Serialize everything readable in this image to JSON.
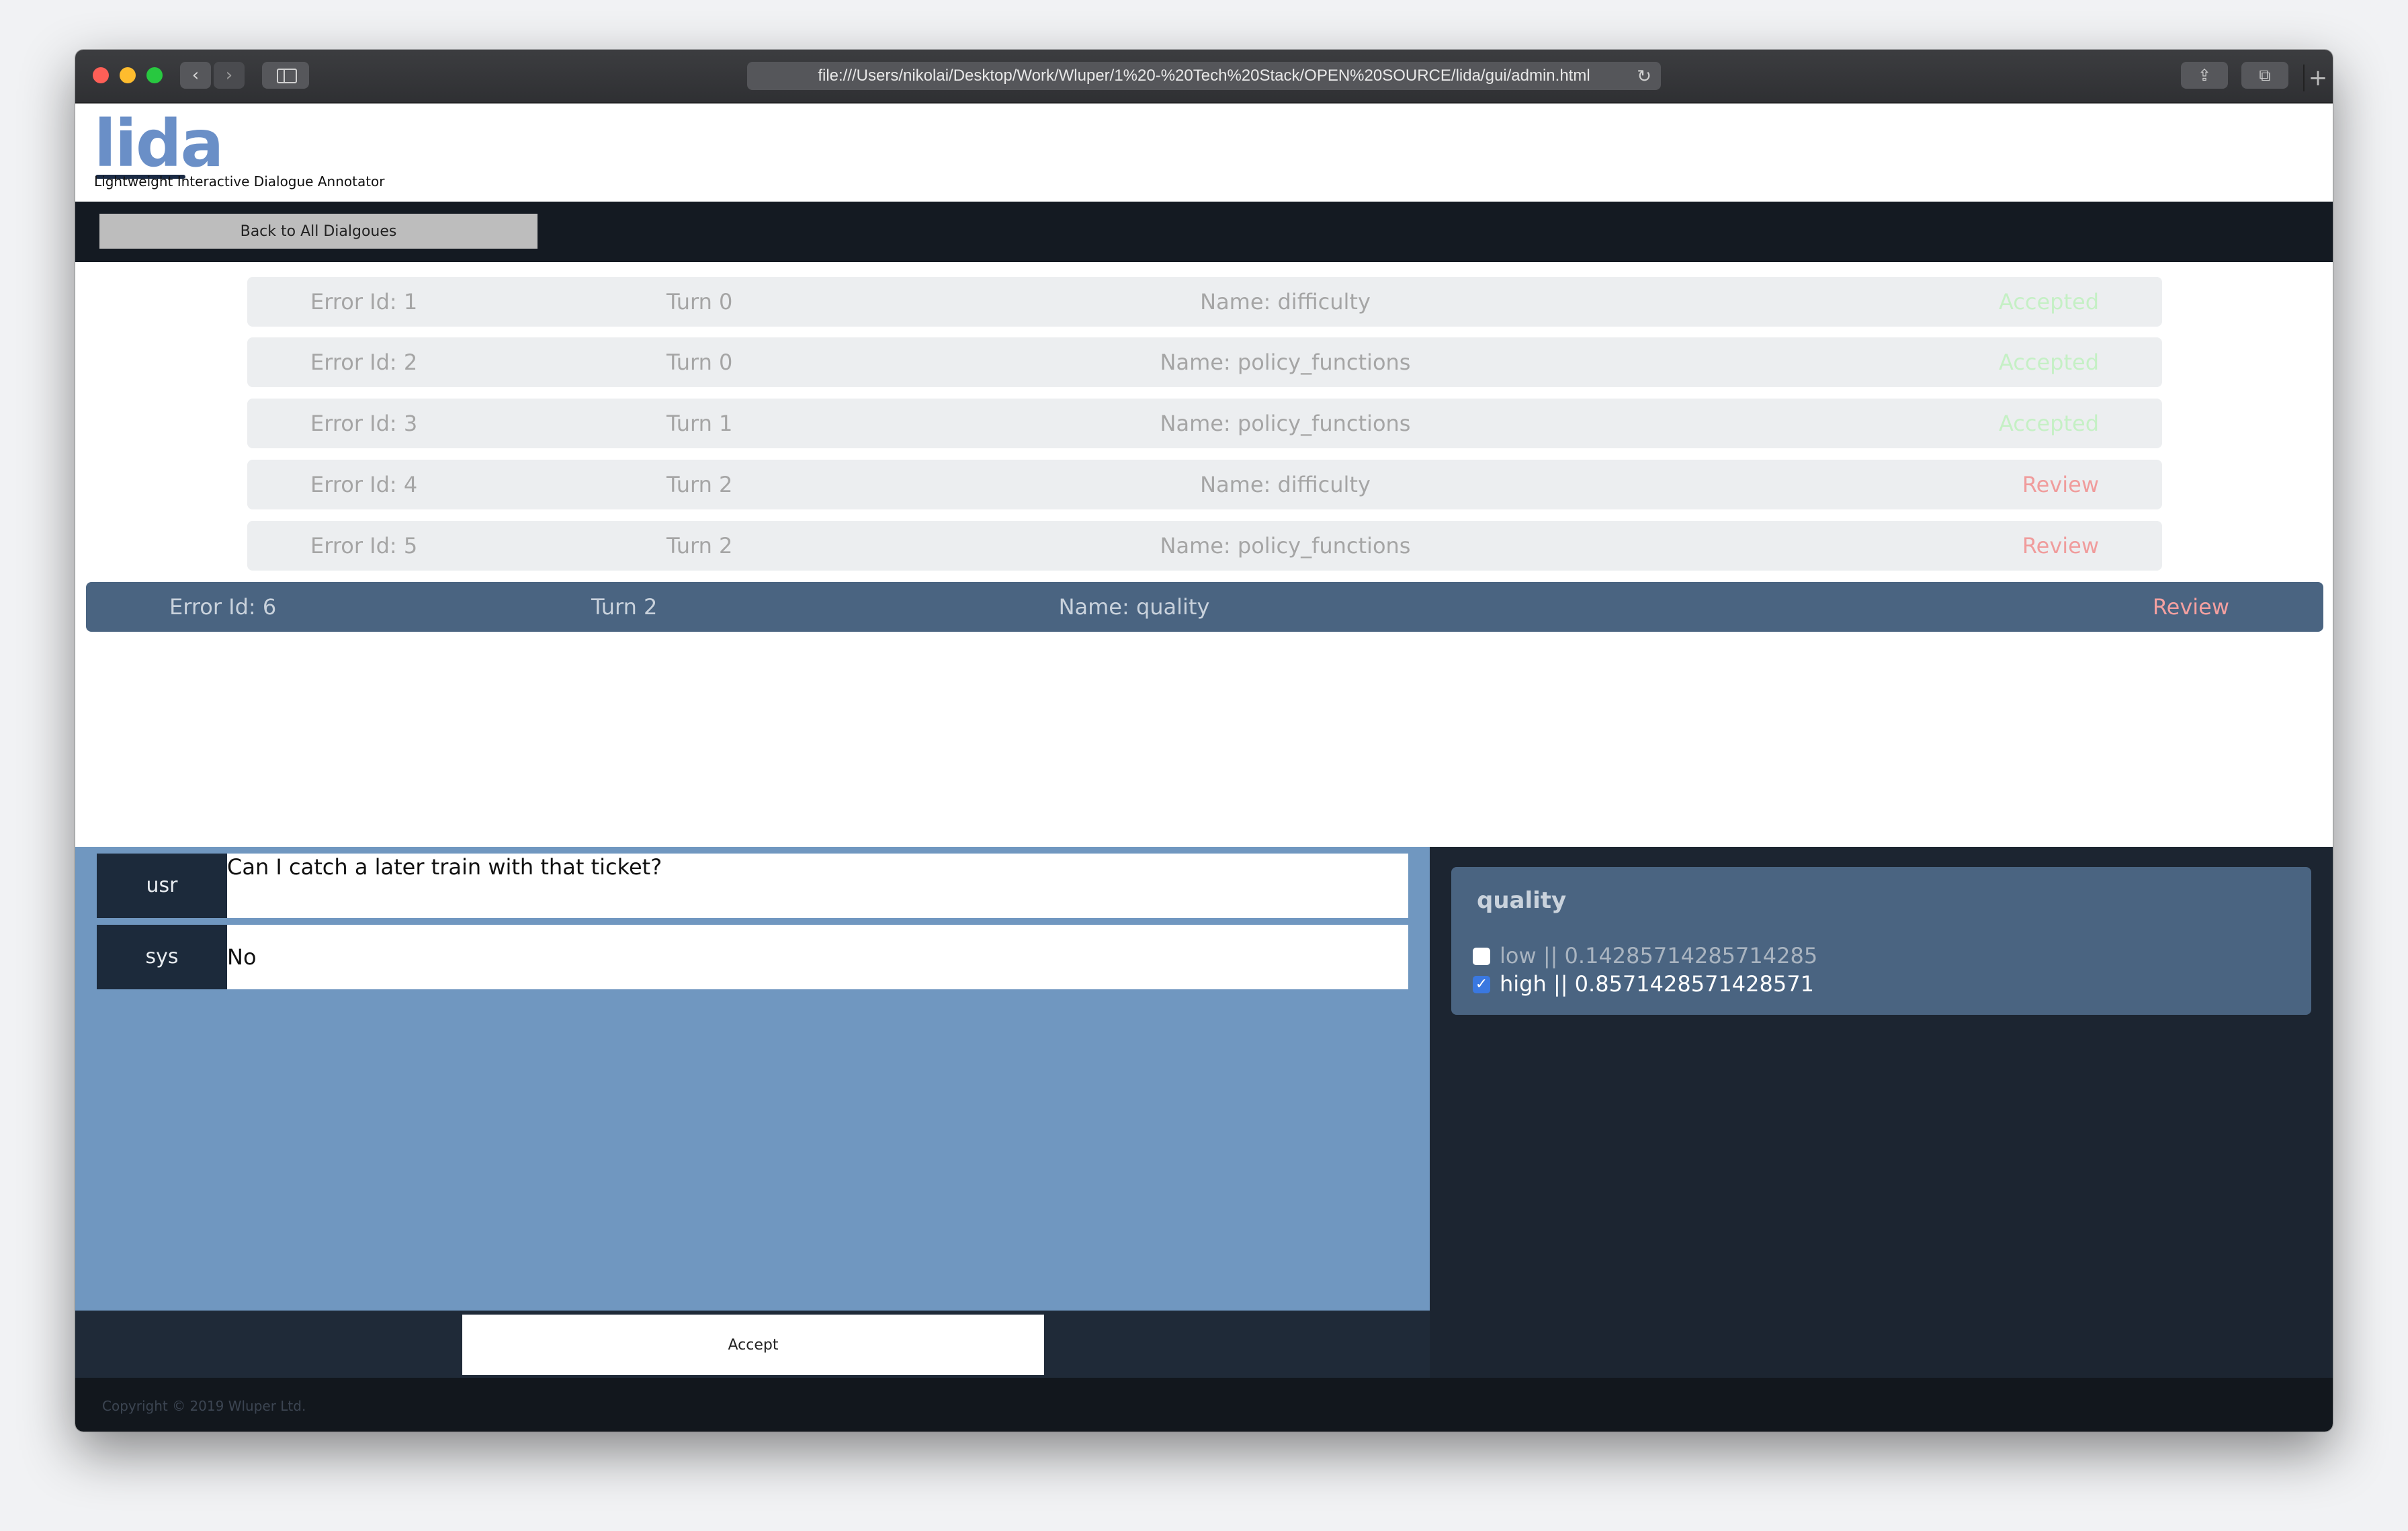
{
  "browser": {
    "url": "file:///Users/nikolai/Desktop/Work/Wluper/1%20-%20Tech%20Stack/OPEN%20SOURCE/lida/gui/admin.html",
    "back_icon": "‹",
    "forward_icon": "›",
    "reload_icon": "↻",
    "share_icon": "⇪",
    "tabs_icon": "⧉",
    "new_tab_icon": "+"
  },
  "header": {
    "logo": "lida",
    "subtitle": "Lightweight Interactive Dialogue Annotator"
  },
  "topbar": {
    "back_label": "Back to All Dialgoues"
  },
  "errors": [
    {
      "id": "Error Id: 1",
      "turn": "Turn 0",
      "name": "Name: difficulty",
      "status": "Accepted"
    },
    {
      "id": "Error Id: 2",
      "turn": "Turn 0",
      "name": "Name: policy_functions",
      "status": "Accepted"
    },
    {
      "id": "Error Id: 3",
      "turn": "Turn 1",
      "name": "Name: policy_functions",
      "status": "Accepted"
    },
    {
      "id": "Error Id: 4",
      "turn": "Turn 2",
      "name": "Name: difficulty",
      "status": "Review"
    },
    {
      "id": "Error Id: 5",
      "turn": "Turn 2",
      "name": "Name: policy_functions",
      "status": "Review"
    },
    {
      "id": "Error Id: 6",
      "turn": "Turn 2",
      "name": "Name: quality",
      "status": "Review"
    }
  ],
  "dialogue": {
    "turns": [
      {
        "speaker": "usr",
        "text": "Can I catch a later train with that ticket?"
      },
      {
        "speaker": "sys",
        "text": "No"
      }
    ],
    "accept_label": "Accept"
  },
  "label": {
    "title": "quality",
    "options": [
      {
        "text": "low || 0.14285714285714285",
        "checked": false
      },
      {
        "text": "high || 0.8571428571428571",
        "checked": true
      }
    ],
    "check_mark": "✓"
  },
  "footer": {
    "copyright": "Copyright © 2019 Wluper Ltd."
  },
  "colors": {
    "accepted": "#c5f0c5",
    "review": "#f09c9c",
    "active_row": "#4a6481",
    "dialogue_bg": "#7097c0",
    "topbar": "#141a22"
  }
}
